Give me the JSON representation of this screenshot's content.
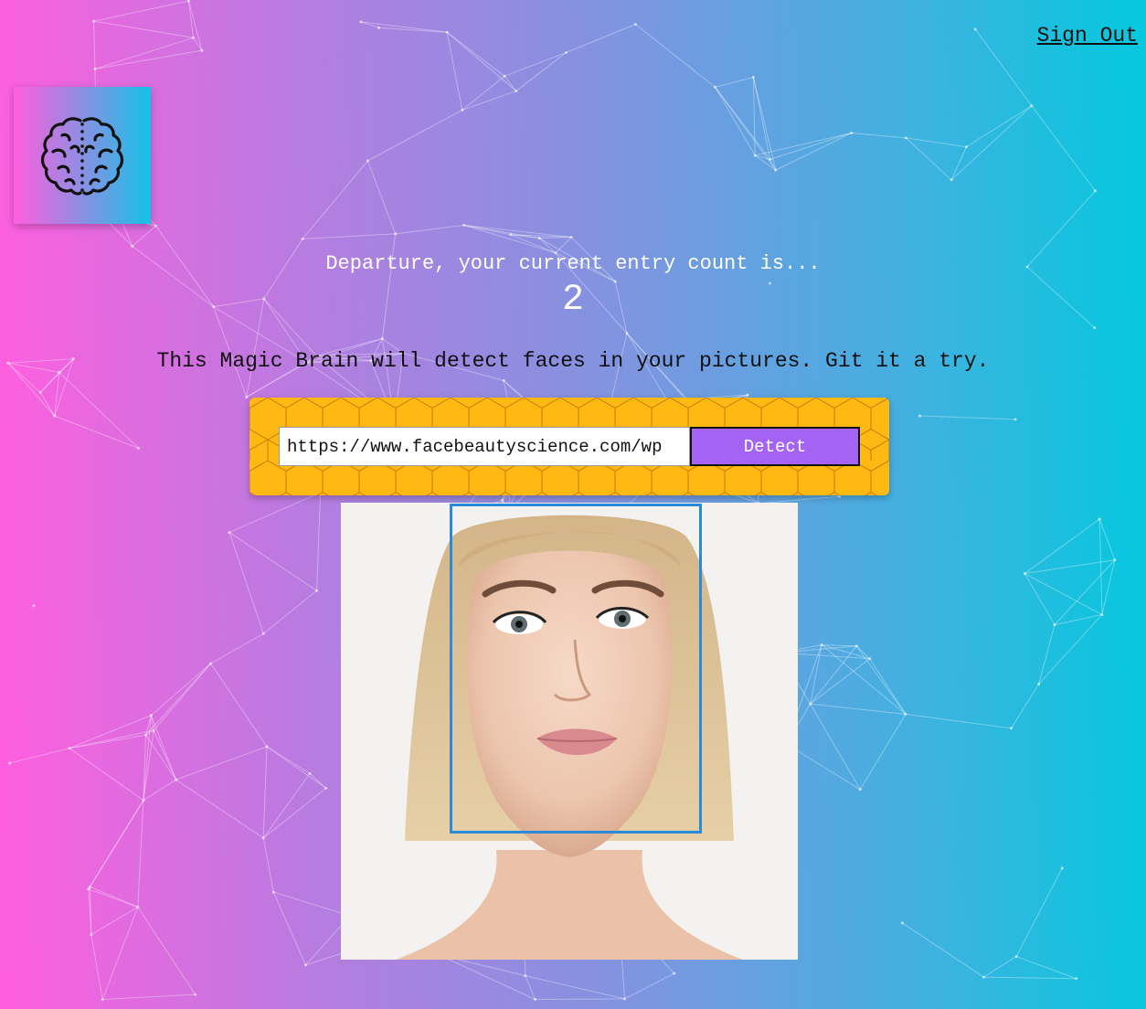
{
  "nav": {
    "sign_out_label": "Sign Out"
  },
  "logo": {
    "icon": "brain-icon"
  },
  "rank": {
    "message": "Departure, your current entry count is...",
    "count": "2"
  },
  "intro": {
    "text": "This Magic Brain will detect faces in your pictures. Git it a try."
  },
  "form": {
    "url_value": "https://www.facebeautyscience.com/wp",
    "detect_label": "Detect"
  },
  "result": {
    "image": "woman-portrait-photo",
    "face_box": "face-bounding-box"
  },
  "colors": {
    "gradient_left": "#ff5edf",
    "gradient_right": "#04c8de",
    "panel_yellow": "#ffb913",
    "button_purple": "#a463f2",
    "box_blue": "#2b8ad9"
  }
}
